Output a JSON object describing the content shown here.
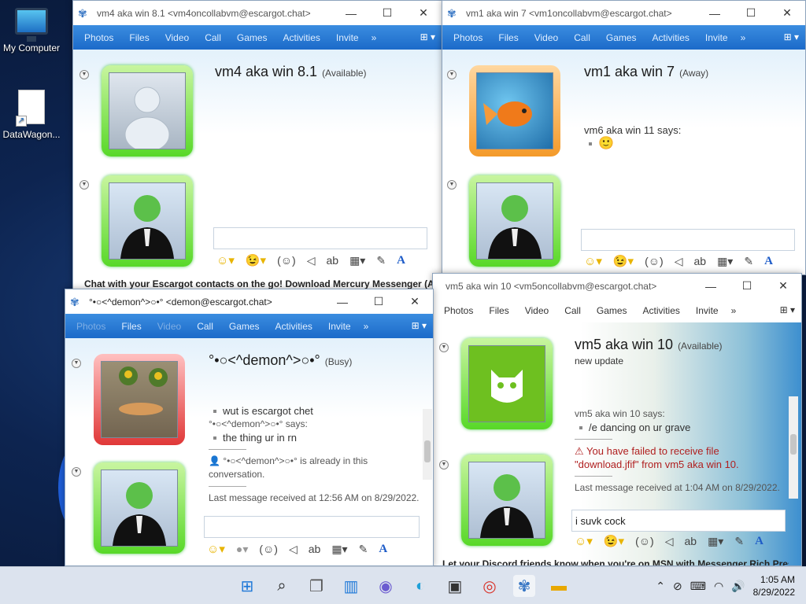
{
  "desktop": {
    "icons": [
      {
        "label": "My Computer",
        "icon": "monitor-icon"
      },
      {
        "label": "DataWagon...",
        "icon": "file-shortcut-icon"
      }
    ]
  },
  "menu_items": [
    "Photos",
    "Files",
    "Video",
    "Call",
    "Games",
    "Activities",
    "Invite"
  ],
  "win1": {
    "title": "vm4 aka win 8.1 <vm4oncollabvm@escargot.chat>",
    "contact_name": "vm4 aka win 8.1",
    "contact_status": "(Available)",
    "banner": "Chat with your Escargot contacts on the go! Download Mercury Messenger (A..."
  },
  "win2": {
    "title": "vm1 aka win 7 <vm1oncollabvm@escargot.chat>",
    "contact_name": "vm1 aka win 7",
    "contact_status": "(Away)",
    "says": "vm6 aka win 11 says:",
    "message_emoticon": "🙂"
  },
  "win3": {
    "title": "°•○<^demon^>○•° <demon@escargot.chat>",
    "contact_name": "°•○<^demon^>○•°",
    "contact_status": "(Busy)",
    "msg1": "wut is escargot chet",
    "says": "°•○<^demon^>○•° says:",
    "msg2": "the thing ur in rn",
    "notice": "°•○<^demon^>○•° is already in this conversation.",
    "last_received": "Last message received at 12:56 AM on 8/29/2022."
  },
  "win4": {
    "title": "vm5 aka win 10 <vm5oncollabvm@escargot.chat>",
    "contact_name": "vm5 aka win 10",
    "contact_status": "(Available)",
    "psm": "new update",
    "says": "vm5 aka win 10 says:",
    "msg1": "/e dancing on ur grave",
    "error": "You have failed to receive file \"download.jfif\" from vm5 aka win 10.",
    "last_received": "Last message received at 1:04 AM on 8/29/2022.",
    "input_value": "i suvk cock",
    "banner": "Let your Discord friends know when you're on MSN with Messenger Rich Pres..."
  },
  "taskbar": {
    "time": "1:05 AM",
    "date": "8/29/2022"
  },
  "colors": {
    "menubar": "#1c6ac9",
    "available_frame": "#58d828",
    "away_frame": "#f49a2a",
    "busy_frame": "#e03838"
  }
}
